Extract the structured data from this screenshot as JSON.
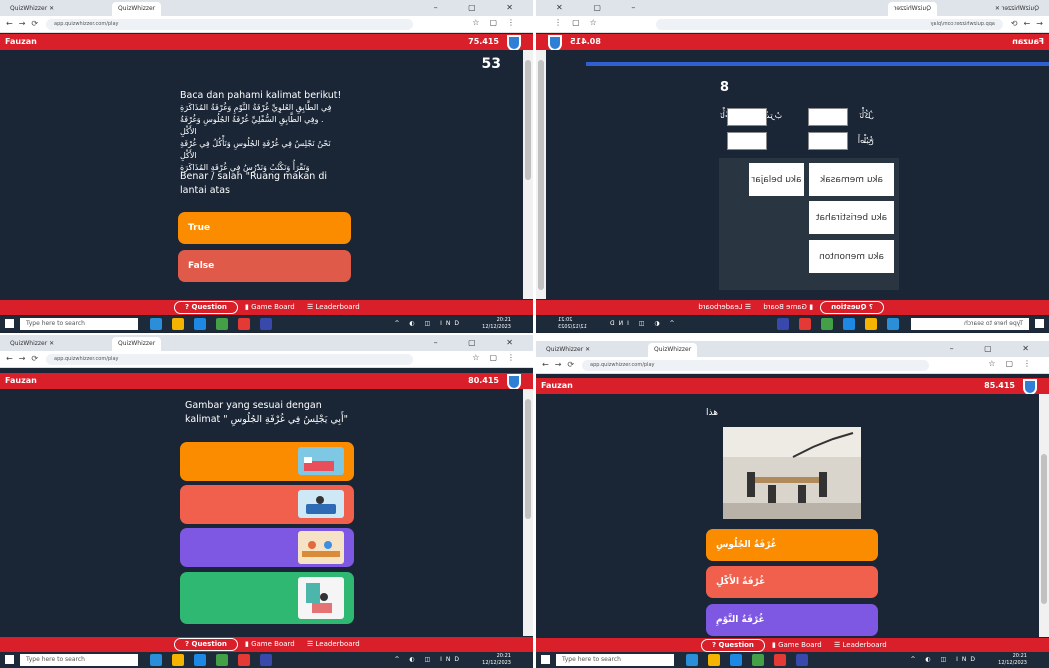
{
  "browser": {
    "tab1": "QuizWhizzer",
    "tab2": "QuizWhizzer",
    "url": "app.quizwhizzer.com/play"
  },
  "player": {
    "name": "Fauzan"
  },
  "nav": {
    "question": "Question",
    "gameboard": "Game Board",
    "leaderboard": "Leaderboard"
  },
  "taskbar": {
    "search_placeholder": "Type here to search",
    "lang": "IND",
    "time": "20:21",
    "date": "12/12/2023"
  },
  "q1": {
    "score": "75.415",
    "timer": "53",
    "prompt": "Baca dan pahami kalimat berikut!",
    "arabic_lines": [
      "فِي الطَّابِقِ العُلوِيِّ غُرْفَةُ النَّوْمِ وَغُرْفَةُ المُذَاكَرَةِ",
      ". وفِي الطَّابِقِ السُّفْلِيِّ غُرْفَةُ الجُلُوسِ وَغُرْفَةُ الأَكْلِ",
      "نَحْنُ نَجْلِسُ فِي غُرْفَةِ الجُلُوسِ وَنَأْكُلُ فِي غُرْفَةِ الأَكْلِ",
      "وَنَقْرَأُ وَنَكْتُبُ وَنَدْرُسُ فِي غُرْفَةِ المُذَاكَرَةِ"
    ],
    "question": "Benar / salah \"Ruang makan di lantai atas",
    "answers": [
      {
        "label": "True",
        "color": "#fb8c00"
      },
      {
        "label": "False",
        "color": "#e05a4a"
      }
    ]
  },
  "q2": {
    "score": "80.415",
    "number": "8",
    "arabic_words": [
      "نَأْكُلُ",
      "أَشْرَبُ",
      "نَأْخُذُ",
      "أَطْبُخُ"
    ],
    "eq": "=",
    "cards": [
      "aku memasak",
      "aku belajar",
      "aku beristirahat",
      "aku menonton"
    ]
  },
  "q3": {
    "score": "80.415",
    "question": "Gambar yang sesuai dengan kalimat \" أَبِي يَجْلِسُ فِي غُرْفَةِ الجُلُوسِ\"",
    "answers": [
      {
        "color": "#fb8c00",
        "icon": "bedroom-image"
      },
      {
        "color": "#f0604d",
        "icon": "sofa-image"
      },
      {
        "color": "#7e57e2",
        "icon": "kitchen-image"
      },
      {
        "color": "#2eb872",
        "icon": "reading-image"
      }
    ]
  },
  "q4": {
    "score": "85.415",
    "word": "هذا",
    "answers": [
      {
        "label": "غُرْفَةُ الجُلُوسِ",
        "color": "#fb8c00"
      },
      {
        "label": "غُرْفَةُ الأَكْلِ",
        "color": "#f0604d"
      },
      {
        "label": "غُرْفَةُ النَّوْمِ",
        "color": "#7e57e2"
      }
    ]
  }
}
